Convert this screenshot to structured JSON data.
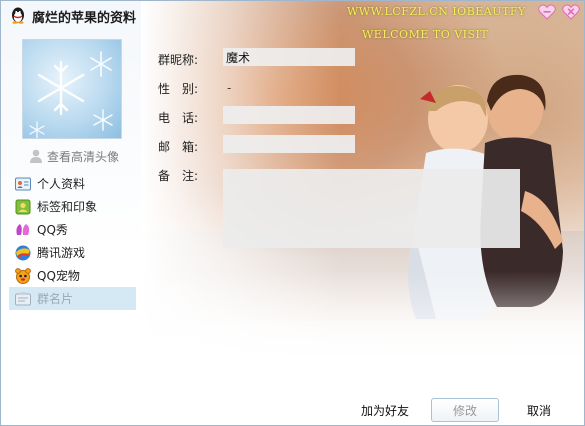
{
  "window": {
    "title": "腐烂的苹果的资料",
    "watermark_line1": "WWW.LCFZL.CN IOBEAUTFY",
    "watermark_line2": "WELCOME TO VISIT"
  },
  "sidebar": {
    "hd_avatar_link": "查看高清头像",
    "items": [
      {
        "label": "个人资料",
        "icon": "profile-card-icon"
      },
      {
        "label": "标签和印象",
        "icon": "tag-icon"
      },
      {
        "label": "QQ秀",
        "icon": "qq-show-icon"
      },
      {
        "label": "腾讯游戏",
        "icon": "game-icon"
      },
      {
        "label": "QQ宠物",
        "icon": "pet-icon"
      },
      {
        "label": "群名片",
        "icon": "group-card-icon",
        "active": true
      }
    ]
  },
  "form": {
    "nickname": {
      "label": "群昵称:",
      "value": "魔术"
    },
    "gender": {
      "label": "性　别:",
      "value": "-"
    },
    "phone": {
      "label": "电　话:",
      "value": ""
    },
    "email": {
      "label": "邮　箱:",
      "value": ""
    },
    "remark": {
      "label": "备　注:",
      "value": ""
    }
  },
  "buttons": {
    "add_friend": "加为好友",
    "edit": "修改",
    "cancel": "取消"
  },
  "colors": {
    "active_item_bg": "#d5e9f5",
    "watermark": "#f2f05a",
    "heart": "#e06bb5"
  }
}
